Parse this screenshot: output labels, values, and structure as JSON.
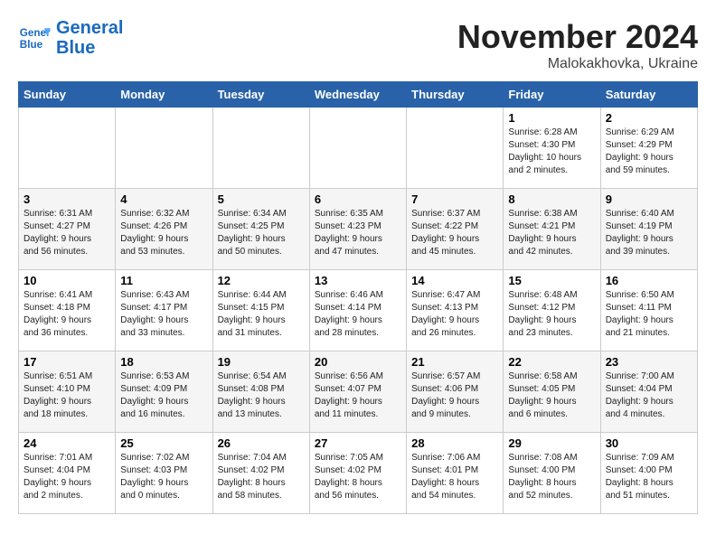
{
  "header": {
    "logo": {
      "line1": "General",
      "line2": "Blue"
    },
    "month": "November 2024",
    "location": "Malokakhovka, Ukraine"
  },
  "weekdays": [
    "Sunday",
    "Monday",
    "Tuesday",
    "Wednesday",
    "Thursday",
    "Friday",
    "Saturday"
  ],
  "weeks": [
    [
      {
        "day": "",
        "info": ""
      },
      {
        "day": "",
        "info": ""
      },
      {
        "day": "",
        "info": ""
      },
      {
        "day": "",
        "info": ""
      },
      {
        "day": "",
        "info": ""
      },
      {
        "day": "1",
        "info": "Sunrise: 6:28 AM\nSunset: 4:30 PM\nDaylight: 10 hours\nand 2 minutes."
      },
      {
        "day": "2",
        "info": "Sunrise: 6:29 AM\nSunset: 4:29 PM\nDaylight: 9 hours\nand 59 minutes."
      }
    ],
    [
      {
        "day": "3",
        "info": "Sunrise: 6:31 AM\nSunset: 4:27 PM\nDaylight: 9 hours\nand 56 minutes."
      },
      {
        "day": "4",
        "info": "Sunrise: 6:32 AM\nSunset: 4:26 PM\nDaylight: 9 hours\nand 53 minutes."
      },
      {
        "day": "5",
        "info": "Sunrise: 6:34 AM\nSunset: 4:25 PM\nDaylight: 9 hours\nand 50 minutes."
      },
      {
        "day": "6",
        "info": "Sunrise: 6:35 AM\nSunset: 4:23 PM\nDaylight: 9 hours\nand 47 minutes."
      },
      {
        "day": "7",
        "info": "Sunrise: 6:37 AM\nSunset: 4:22 PM\nDaylight: 9 hours\nand 45 minutes."
      },
      {
        "day": "8",
        "info": "Sunrise: 6:38 AM\nSunset: 4:21 PM\nDaylight: 9 hours\nand 42 minutes."
      },
      {
        "day": "9",
        "info": "Sunrise: 6:40 AM\nSunset: 4:19 PM\nDaylight: 9 hours\nand 39 minutes."
      }
    ],
    [
      {
        "day": "10",
        "info": "Sunrise: 6:41 AM\nSunset: 4:18 PM\nDaylight: 9 hours\nand 36 minutes."
      },
      {
        "day": "11",
        "info": "Sunrise: 6:43 AM\nSunset: 4:17 PM\nDaylight: 9 hours\nand 33 minutes."
      },
      {
        "day": "12",
        "info": "Sunrise: 6:44 AM\nSunset: 4:15 PM\nDaylight: 9 hours\nand 31 minutes."
      },
      {
        "day": "13",
        "info": "Sunrise: 6:46 AM\nSunset: 4:14 PM\nDaylight: 9 hours\nand 28 minutes."
      },
      {
        "day": "14",
        "info": "Sunrise: 6:47 AM\nSunset: 4:13 PM\nDaylight: 9 hours\nand 26 minutes."
      },
      {
        "day": "15",
        "info": "Sunrise: 6:48 AM\nSunset: 4:12 PM\nDaylight: 9 hours\nand 23 minutes."
      },
      {
        "day": "16",
        "info": "Sunrise: 6:50 AM\nSunset: 4:11 PM\nDaylight: 9 hours\nand 21 minutes."
      }
    ],
    [
      {
        "day": "17",
        "info": "Sunrise: 6:51 AM\nSunset: 4:10 PM\nDaylight: 9 hours\nand 18 minutes."
      },
      {
        "day": "18",
        "info": "Sunrise: 6:53 AM\nSunset: 4:09 PM\nDaylight: 9 hours\nand 16 minutes."
      },
      {
        "day": "19",
        "info": "Sunrise: 6:54 AM\nSunset: 4:08 PM\nDaylight: 9 hours\nand 13 minutes."
      },
      {
        "day": "20",
        "info": "Sunrise: 6:56 AM\nSunset: 4:07 PM\nDaylight: 9 hours\nand 11 minutes."
      },
      {
        "day": "21",
        "info": "Sunrise: 6:57 AM\nSunset: 4:06 PM\nDaylight: 9 hours\nand 9 minutes."
      },
      {
        "day": "22",
        "info": "Sunrise: 6:58 AM\nSunset: 4:05 PM\nDaylight: 9 hours\nand 6 minutes."
      },
      {
        "day": "23",
        "info": "Sunrise: 7:00 AM\nSunset: 4:04 PM\nDaylight: 9 hours\nand 4 minutes."
      }
    ],
    [
      {
        "day": "24",
        "info": "Sunrise: 7:01 AM\nSunset: 4:04 PM\nDaylight: 9 hours\nand 2 minutes."
      },
      {
        "day": "25",
        "info": "Sunrise: 7:02 AM\nSunset: 4:03 PM\nDaylight: 9 hours\nand 0 minutes."
      },
      {
        "day": "26",
        "info": "Sunrise: 7:04 AM\nSunset: 4:02 PM\nDaylight: 8 hours\nand 58 minutes."
      },
      {
        "day": "27",
        "info": "Sunrise: 7:05 AM\nSunset: 4:02 PM\nDaylight: 8 hours\nand 56 minutes."
      },
      {
        "day": "28",
        "info": "Sunrise: 7:06 AM\nSunset: 4:01 PM\nDaylight: 8 hours\nand 54 minutes."
      },
      {
        "day": "29",
        "info": "Sunrise: 7:08 AM\nSunset: 4:00 PM\nDaylight: 8 hours\nand 52 minutes."
      },
      {
        "day": "30",
        "info": "Sunrise: 7:09 AM\nSunset: 4:00 PM\nDaylight: 8 hours\nand 51 minutes."
      }
    ]
  ]
}
